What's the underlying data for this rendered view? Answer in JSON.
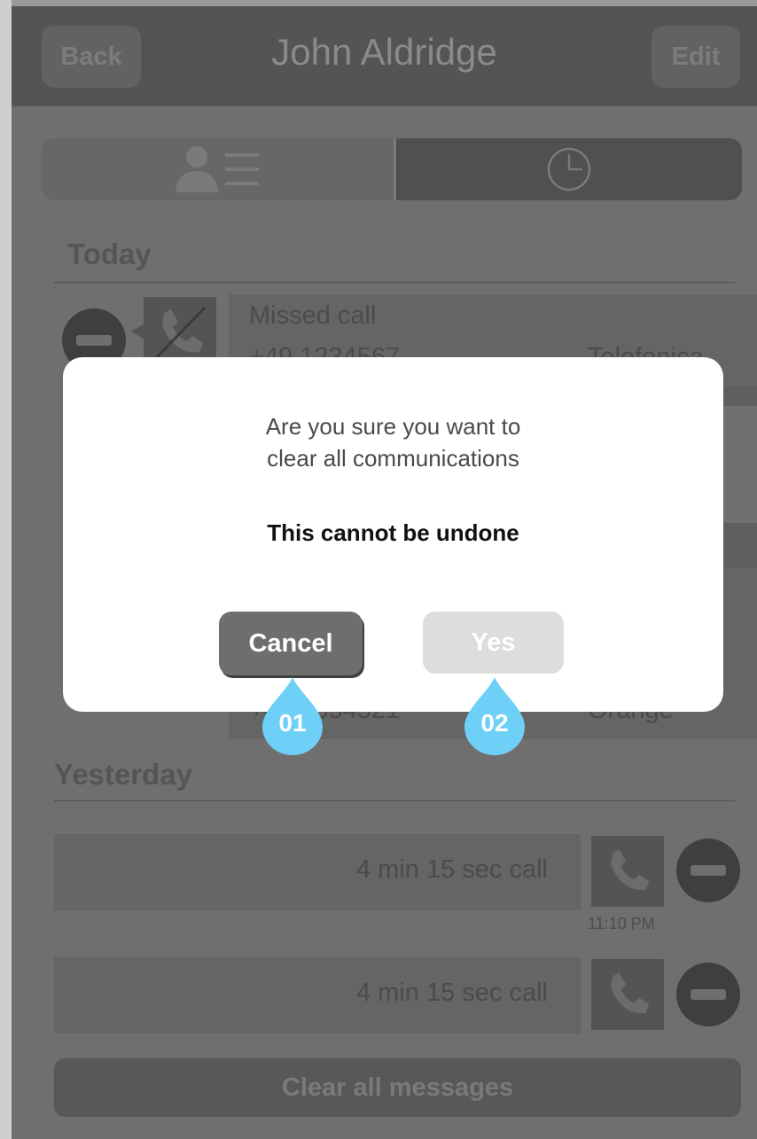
{
  "header": {
    "back_label": "Back",
    "title": "John Aldridge",
    "edit_label": "Edit"
  },
  "sections": {
    "today": "Today",
    "yesterday": "Yesterday"
  },
  "today_rows": [
    {
      "type": "Missed call",
      "number": "+49 1234567",
      "carrier": "Telefonica"
    },
    {
      "number": "+49 7654321",
      "carrier": "Orange"
    }
  ],
  "yesterday_rows": [
    {
      "text": "4 min 15 sec call",
      "time": "11:10 PM"
    },
    {
      "text": "4 min 15 sec call"
    }
  ],
  "clear_button": "Clear all messages",
  "dialog": {
    "question_line1": "Are you sure you want to",
    "question_line2": "clear all communications",
    "warning": "This cannot be undone",
    "cancel_label": "Cancel",
    "yes_label": "Yes"
  },
  "markers": {
    "cancel": "01",
    "yes": "02"
  },
  "colors": {
    "marker": "#6fd0f7",
    "dialog_bg": "#ffffff",
    "overlay": "#6f6f6f"
  }
}
